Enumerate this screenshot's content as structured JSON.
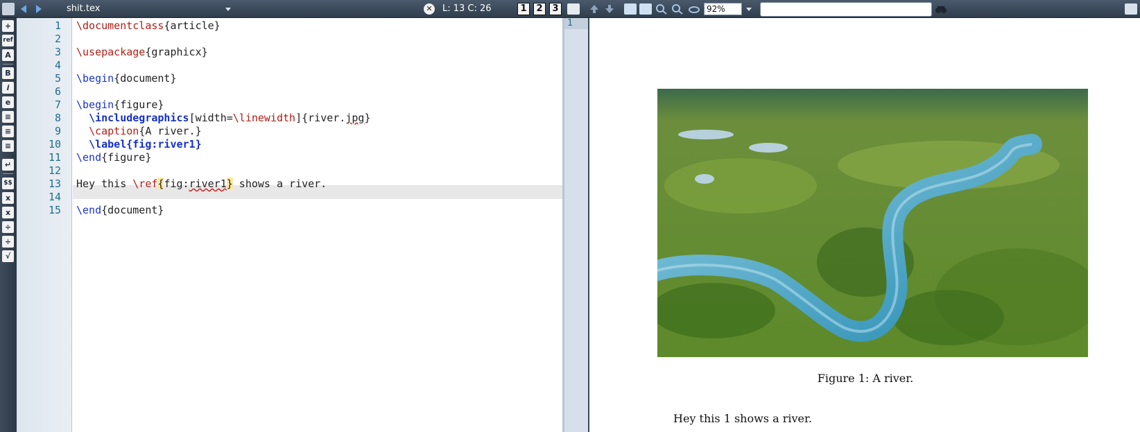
{
  "topbar": {
    "filename": "shit.tex",
    "cursor_position": "L: 13 C: 26",
    "view_buttons": [
      "1",
      "2",
      "3"
    ],
    "zoom": "92%",
    "search_value": ""
  },
  "editor": {
    "line_numbers": [
      "1",
      "2",
      "3",
      "4",
      "5",
      "6",
      "7",
      "8",
      "9",
      "10",
      "11",
      "12",
      "13",
      "14",
      "15"
    ],
    "current_line": 13,
    "lines": {
      "l1_cmd": "\\documentclass",
      "l1_arg": "{article}",
      "l3_cmd": "\\usepackage",
      "l3_arg": "{graphicx}",
      "l5_cmd": "\\begin",
      "l5_arg": "{document}",
      "l7_cmd": "\\begin",
      "l7_arg": "{figure}",
      "l8_indent": "  ",
      "l8_cmd": "\\includegraphics",
      "l8_opt_a": "[width=",
      "l8_opt_cmd": "\\linewidth",
      "l8_opt_b": "]{river.",
      "l8_ext": "jpg",
      "l8_end": "}",
      "l9_indent": "  ",
      "l9_cmd": "\\caption",
      "l9_arg": "{A river.}",
      "l10_indent": "  ",
      "l10_cmd": "\\label{fig:river1}",
      "l11_cmd": "\\end",
      "l11_arg": "{figure}",
      "l13_a": "Hey this ",
      "l13_cmd": "\\ref",
      "l13_ob": "{",
      "l13_fig": "fig:",
      "l13_label": "river1",
      "l13_cb": "}",
      "l13_b": " shows a river.",
      "l15_cmd": "\\end",
      "l15_arg": "{document}"
    }
  },
  "pdf": {
    "gutter_line": "1",
    "figure_caption": "Figure 1:  A river.",
    "body_text": "Hey this 1 shows a river."
  },
  "colors": {
    "command_red": "#b02018",
    "command_blue": "#1a33cc",
    "line_number": "#1e6f8a",
    "topbar": "#3a4858"
  }
}
